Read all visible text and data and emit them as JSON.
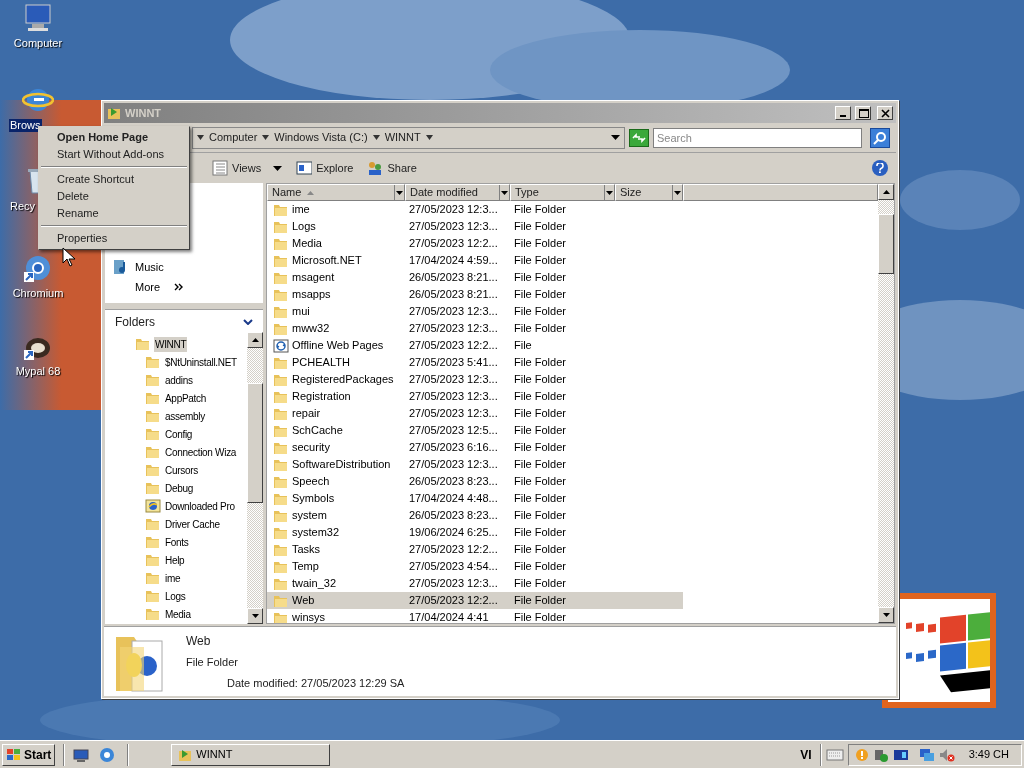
{
  "desktop_icons": [
    {
      "label": "Computer",
      "kind": "computer",
      "selected": false
    },
    {
      "label": "Brows",
      "kind": "browser",
      "selected": true
    },
    {
      "label": "Recy",
      "kind": "recycle",
      "selected": false
    },
    {
      "label": "Chromium",
      "kind": "chromium",
      "selected": false
    },
    {
      "label": "Mypal 68",
      "kind": "mypal",
      "selected": false
    }
  ],
  "window": {
    "title": "WINNT",
    "active": false,
    "address": [
      "Computer",
      "Windows Vista (C:)",
      "WINNT"
    ],
    "search": {
      "placeholder": "Search"
    },
    "toolbar": [
      "Views",
      "Explore",
      "Share"
    ],
    "links": [
      "Music",
      "More"
    ],
    "folders_header": "Folders",
    "tree": [
      {
        "label": "WINNT",
        "kind": "folder",
        "selected": true,
        "children": [
          {
            "label": "$NtUninstall.NET",
            "kind": "folder",
            "selected": false
          },
          {
            "label": "addins",
            "kind": "folder",
            "selected": false
          },
          {
            "label": "AppPatch",
            "kind": "folder",
            "selected": false
          },
          {
            "label": "assembly",
            "kind": "folder",
            "selected": false
          },
          {
            "label": "Config",
            "kind": "folder",
            "selected": false
          },
          {
            "label": "Connection Wiza",
            "kind": "folder",
            "selected": false
          },
          {
            "label": "Cursors",
            "kind": "folder",
            "selected": false
          },
          {
            "label": "Debug",
            "kind": "folder",
            "selected": false
          },
          {
            "label": "Downloaded Pro",
            "kind": "web",
            "selected": false
          },
          {
            "label": "Driver Cache",
            "kind": "folder",
            "selected": false
          },
          {
            "label": "Fonts",
            "kind": "folder",
            "selected": false
          },
          {
            "label": "Help",
            "kind": "folder",
            "selected": false
          },
          {
            "label": "ime",
            "kind": "folder",
            "selected": false
          },
          {
            "label": "Logs",
            "kind": "folder",
            "selected": false
          },
          {
            "label": "Media",
            "kind": "folder",
            "selected": false
          }
        ]
      }
    ],
    "columns": [
      "Name",
      "Date modified",
      "Type",
      "Size"
    ],
    "rows": [
      {
        "name": "ime",
        "date": "27/05/2023 12:3...",
        "type": "File Folder",
        "kind": "folder",
        "selected": false
      },
      {
        "name": "Logs",
        "date": "27/05/2023 12:3...",
        "type": "File Folder",
        "kind": "folder",
        "selected": false
      },
      {
        "name": "Media",
        "date": "27/05/2023 12:2...",
        "type": "File Folder",
        "kind": "folder",
        "selected": false
      },
      {
        "name": "Microsoft.NET",
        "date": "17/04/2024 4:59...",
        "type": "File Folder",
        "kind": "folder",
        "selected": false
      },
      {
        "name": "msagent",
        "date": "26/05/2023 8:21...",
        "type": "File Folder",
        "kind": "folder",
        "selected": false
      },
      {
        "name": "msapps",
        "date": "26/05/2023 8:21...",
        "type": "File Folder",
        "kind": "folder",
        "selected": false
      },
      {
        "name": "mui",
        "date": "27/05/2023 12:3...",
        "type": "File Folder",
        "kind": "folder",
        "selected": false
      },
      {
        "name": "mww32",
        "date": "27/05/2023 12:3...",
        "type": "File Folder",
        "kind": "folder",
        "selected": false
      },
      {
        "name": "Offline Web Pages",
        "date": "27/05/2023 12:2...",
        "type": "File",
        "kind": "offline",
        "selected": false
      },
      {
        "name": "PCHEALTH",
        "date": "27/05/2023 5:41...",
        "type": "File Folder",
        "kind": "folder",
        "selected": false
      },
      {
        "name": "RegisteredPackages",
        "date": "27/05/2023 12:3...",
        "type": "File Folder",
        "kind": "folder",
        "selected": false
      },
      {
        "name": "Registration",
        "date": "27/05/2023 12:3...",
        "type": "File Folder",
        "kind": "folder",
        "selected": false
      },
      {
        "name": "repair",
        "date": "27/05/2023 12:3...",
        "type": "File Folder",
        "kind": "folder",
        "selected": false
      },
      {
        "name": "SchCache",
        "date": "27/05/2023 12:5...",
        "type": "File Folder",
        "kind": "folder",
        "selected": false
      },
      {
        "name": "security",
        "date": "27/05/2023 6:16...",
        "type": "File Folder",
        "kind": "folder",
        "selected": false
      },
      {
        "name": "SoftwareDistribution",
        "date": "27/05/2023 12:3...",
        "type": "File Folder",
        "kind": "folder",
        "selected": false
      },
      {
        "name": "Speech",
        "date": "26/05/2023 8:23...",
        "type": "File Folder",
        "kind": "folder",
        "selected": false
      },
      {
        "name": "Symbols",
        "date": "17/04/2024 4:48...",
        "type": "File Folder",
        "kind": "folder",
        "selected": false
      },
      {
        "name": "system",
        "date": "26/05/2023 8:23...",
        "type": "File Folder",
        "kind": "folder",
        "selected": false
      },
      {
        "name": "system32",
        "date": "19/06/2024 6:25...",
        "type": "File Folder",
        "kind": "folder",
        "selected": false
      },
      {
        "name": "Tasks",
        "date": "27/05/2023 12:2...",
        "type": "File Folder",
        "kind": "folder",
        "selected": false
      },
      {
        "name": "Temp",
        "date": "27/05/2023 4:54...",
        "type": "File Folder",
        "kind": "folder",
        "selected": false
      },
      {
        "name": "twain_32",
        "date": "27/05/2023 12:3...",
        "type": "File Folder",
        "kind": "folder",
        "selected": false
      },
      {
        "name": "Web",
        "date": "27/05/2023 12:2...",
        "type": "File Folder",
        "kind": "folder",
        "selected": true
      },
      {
        "name": "winsys",
        "date": "17/04/2024 4:41",
        "type": "File Folder",
        "kind": "folder",
        "selected": false
      }
    ],
    "details": {
      "name": "Web",
      "type": "File Folder",
      "modified": "Date modified: 27/05/2023 12:29 SA"
    }
  },
  "context_menu": [
    {
      "label": "Open Home Page",
      "default": true
    },
    {
      "label": "Start Without Add-ons",
      "default": false
    },
    {
      "kind": "separator"
    },
    {
      "label": "Create Shortcut",
      "default": false
    },
    {
      "label": "Delete",
      "default": false
    },
    {
      "label": "Rename",
      "default": false
    },
    {
      "kind": "separator"
    },
    {
      "label": "Properties",
      "default": false
    }
  ],
  "taskbar": {
    "start": "Start",
    "tasks": [
      {
        "label": "WINNT",
        "selected": false
      }
    ],
    "language": "VI",
    "clock": "3:49 CH"
  }
}
